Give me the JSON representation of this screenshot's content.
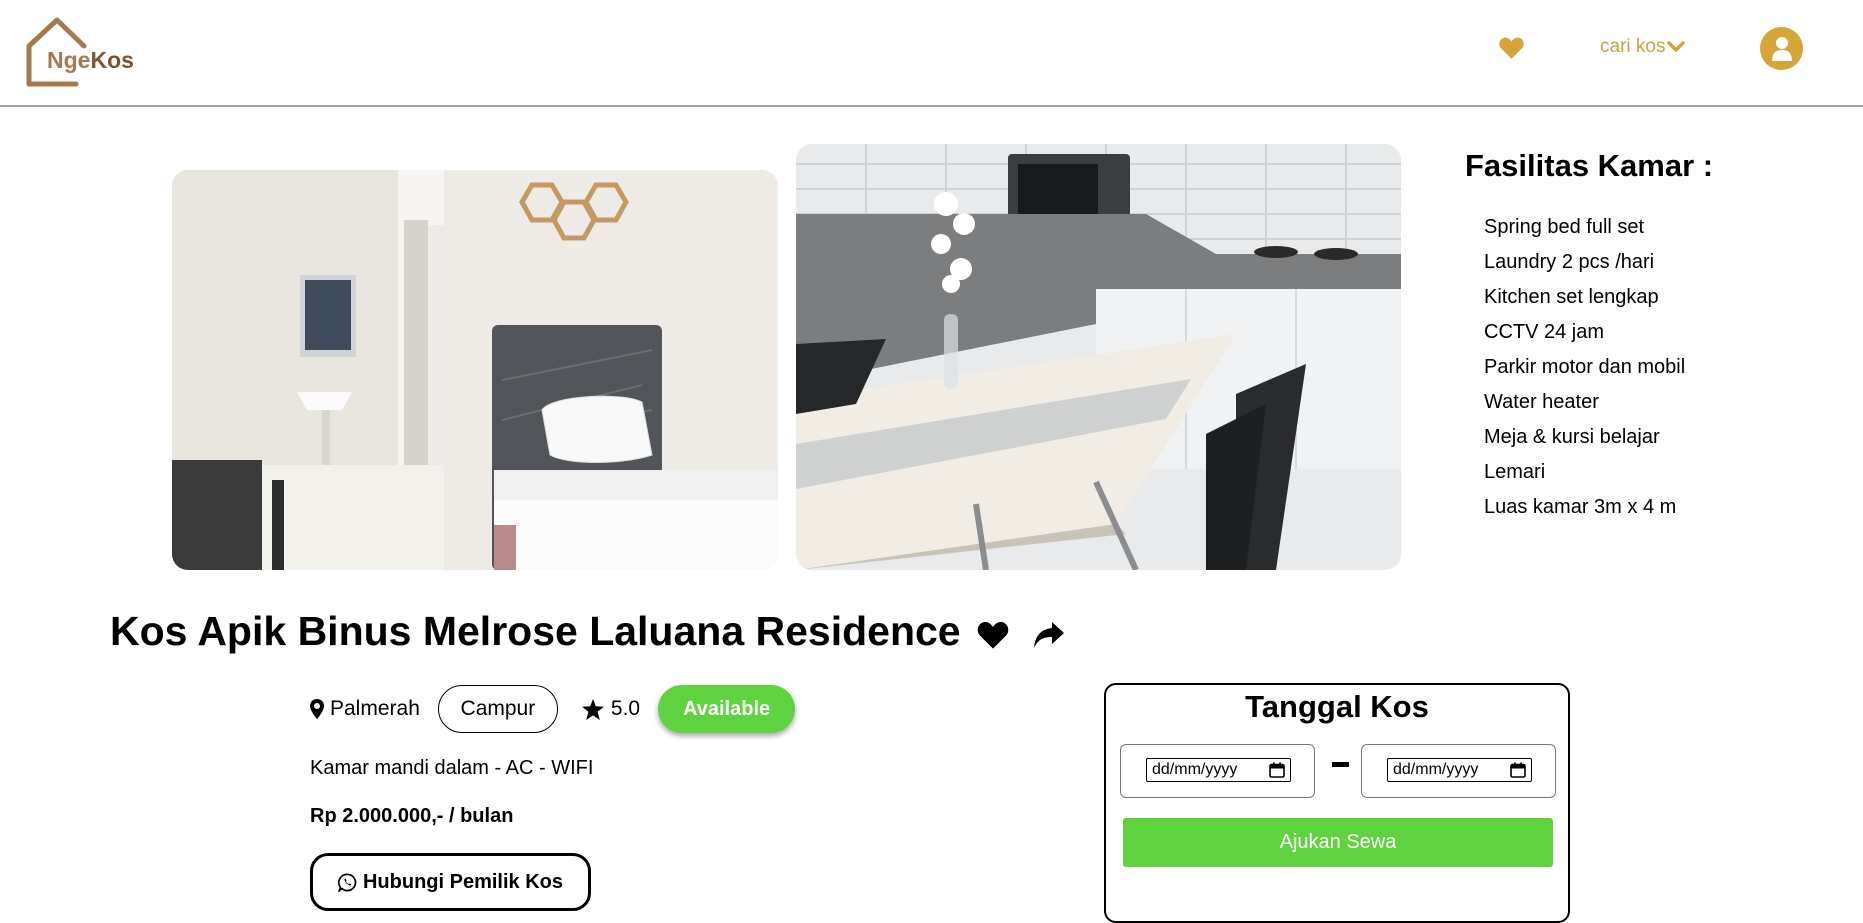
{
  "header": {
    "logo_text_a": "Nge",
    "logo_text_b": "Kos",
    "search_menu_label": "cari kos",
    "brand_color": "#c9a33f"
  },
  "facilities": {
    "title": "Fasilitas Kamar :",
    "items": [
      "Spring bed full set",
      "Laundry 2 pcs /hari",
      "Kitchen set lengkap",
      "CCTV 24 jam",
      "Parkir motor dan mobil",
      "Water heater",
      "Meja & kursi belajar",
      "Lemari",
      "Luas kamar 3m x 4 m"
    ]
  },
  "kos": {
    "title": "Kos Apik Binus Melrose Laluana Residence",
    "location": "Palmerah",
    "gender": "Campur",
    "rating": "5.0",
    "status": "Available",
    "features": "Kamar mandi dalam - AC - WIFI",
    "price": "Rp 2.000.000,- / bulan",
    "contact_label": "Hubungi Pemilik Kos",
    "status_color": "#5fd33f"
  },
  "booking": {
    "title": "Tanggal Kos",
    "start_placeholder": "dd/mm/yyyy",
    "end_placeholder": "dd/mm/yyyy",
    "submit_label": "Ajukan Sewa"
  }
}
